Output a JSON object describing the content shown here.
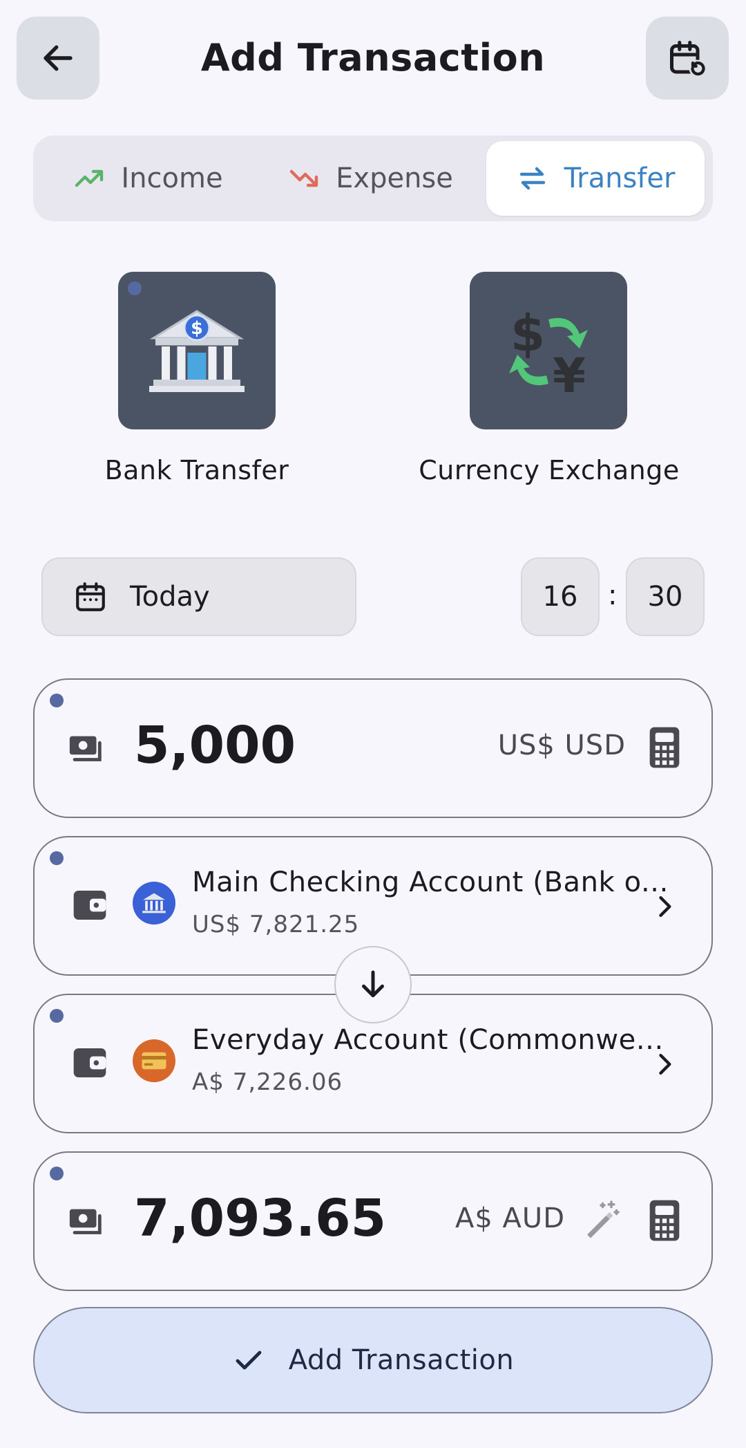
{
  "header": {
    "title": "Add Transaction",
    "back_icon": "arrow-left-icon",
    "history_icon": "calendar-history-icon"
  },
  "type_tabs": [
    {
      "label": "Income",
      "icon": "trending-up-icon",
      "color": "#5bb36a",
      "active": false
    },
    {
      "label": "Expense",
      "icon": "trending-down-icon",
      "color": "#e06a5c",
      "active": false
    },
    {
      "label": "Transfer",
      "icon": "swap-horizontal-icon",
      "color": "#3b82c4",
      "active": true
    }
  ],
  "categories": [
    {
      "label": "Bank Transfer",
      "icon": "bank-icon",
      "selected": true
    },
    {
      "label": "Currency Exchange",
      "icon": "currency-exchange-icon",
      "selected": false
    }
  ],
  "date": {
    "label": "Today",
    "icon": "calendar-icon"
  },
  "time": {
    "hour": "16",
    "separator": ":",
    "minute": "30"
  },
  "from_amount": {
    "value": "5,000",
    "currency": "US$ USD",
    "icon": "cash-icon",
    "calc_icon": "calculator-icon"
  },
  "from_account": {
    "name": "Main Checking Account (Bank o...",
    "balance": "US$ 7,821.25",
    "icon": "wallet-icon",
    "logo_icon": "bank-icon",
    "logo_color": "#3a62d6"
  },
  "to_account": {
    "name": "Everyday Account (Commonwe...",
    "balance": "A$ 7,226.06",
    "icon": "wallet-icon",
    "logo_icon": "credit-card-icon",
    "logo_color": "#d8672a"
  },
  "to_amount": {
    "value": "7,093.65",
    "currency": "A$ AUD",
    "icon": "cash-icon",
    "magic_icon": "magic-wand-icon",
    "calc_icon": "calculator-icon"
  },
  "submit": {
    "label": "Add Transaction",
    "icon": "check-icon"
  },
  "colors": {
    "accent": "#3b82c4",
    "background": "#f8f6fd",
    "submit_bg": "#dbe4f8"
  }
}
